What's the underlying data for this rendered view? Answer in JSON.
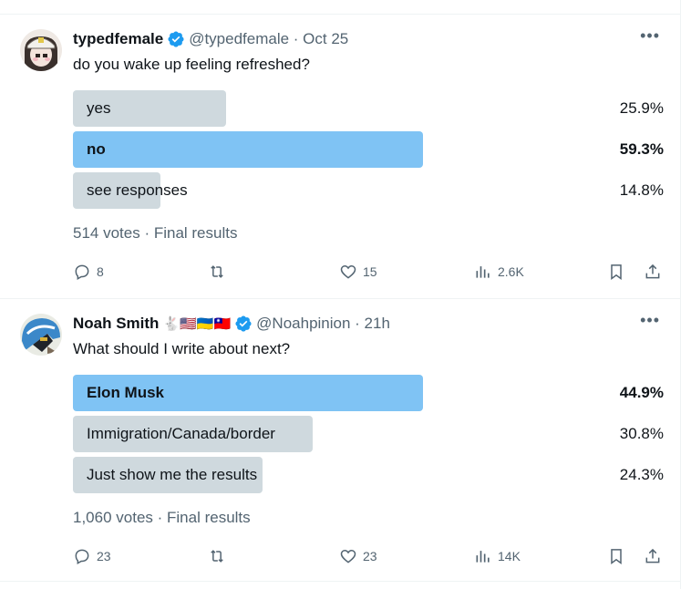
{
  "tweets": [
    {
      "user_name": "typedfemale",
      "handle_date": "@typedfemale · Oct 25",
      "question": "do you wake up feeling refreshed?",
      "options": [
        {
          "label": "yes",
          "pct": "25.9%",
          "fraction": 0.259,
          "winner": false
        },
        {
          "label": "no",
          "pct": "59.3%",
          "fraction": 0.593,
          "winner": true
        },
        {
          "label": "see responses",
          "pct": "14.8%",
          "fraction": 0.148,
          "winner": false
        }
      ],
      "meta": "514 votes · Final results",
      "actions": {
        "replies": "8",
        "reposts": "",
        "likes": "15",
        "views": "2.6K"
      }
    },
    {
      "user_name": "Noah Smith",
      "name_emojis": "🐇🇺🇸🇺🇦🇹🇼",
      "handle_date": "@Noahpinion · 21h",
      "question": "What should I write about next?",
      "options": [
        {
          "label": "Elon Musk",
          "pct": "44.9%",
          "fraction": 0.449,
          "winner": true
        },
        {
          "label": "Immigration/Canada/border",
          "pct": "30.8%",
          "fraction": 0.308,
          "winner": false
        },
        {
          "label": "Just show me the results",
          "pct": "24.3%",
          "fraction": 0.243,
          "winner": false
        }
      ],
      "meta": "1,060 votes · Final results",
      "actions": {
        "replies": "23",
        "reposts": "",
        "likes": "23",
        "views": "14K"
      }
    }
  ],
  "colors": {
    "winner_bar": "#7fc3f4",
    "bar": "#cfd9de",
    "secondary_text": "#536471",
    "verified": "#1d9bf0"
  },
  "icons": [
    "verified-badge-icon",
    "more-icon",
    "reply-icon",
    "repost-icon",
    "like-icon",
    "views-icon",
    "bookmark-icon",
    "share-icon"
  ]
}
